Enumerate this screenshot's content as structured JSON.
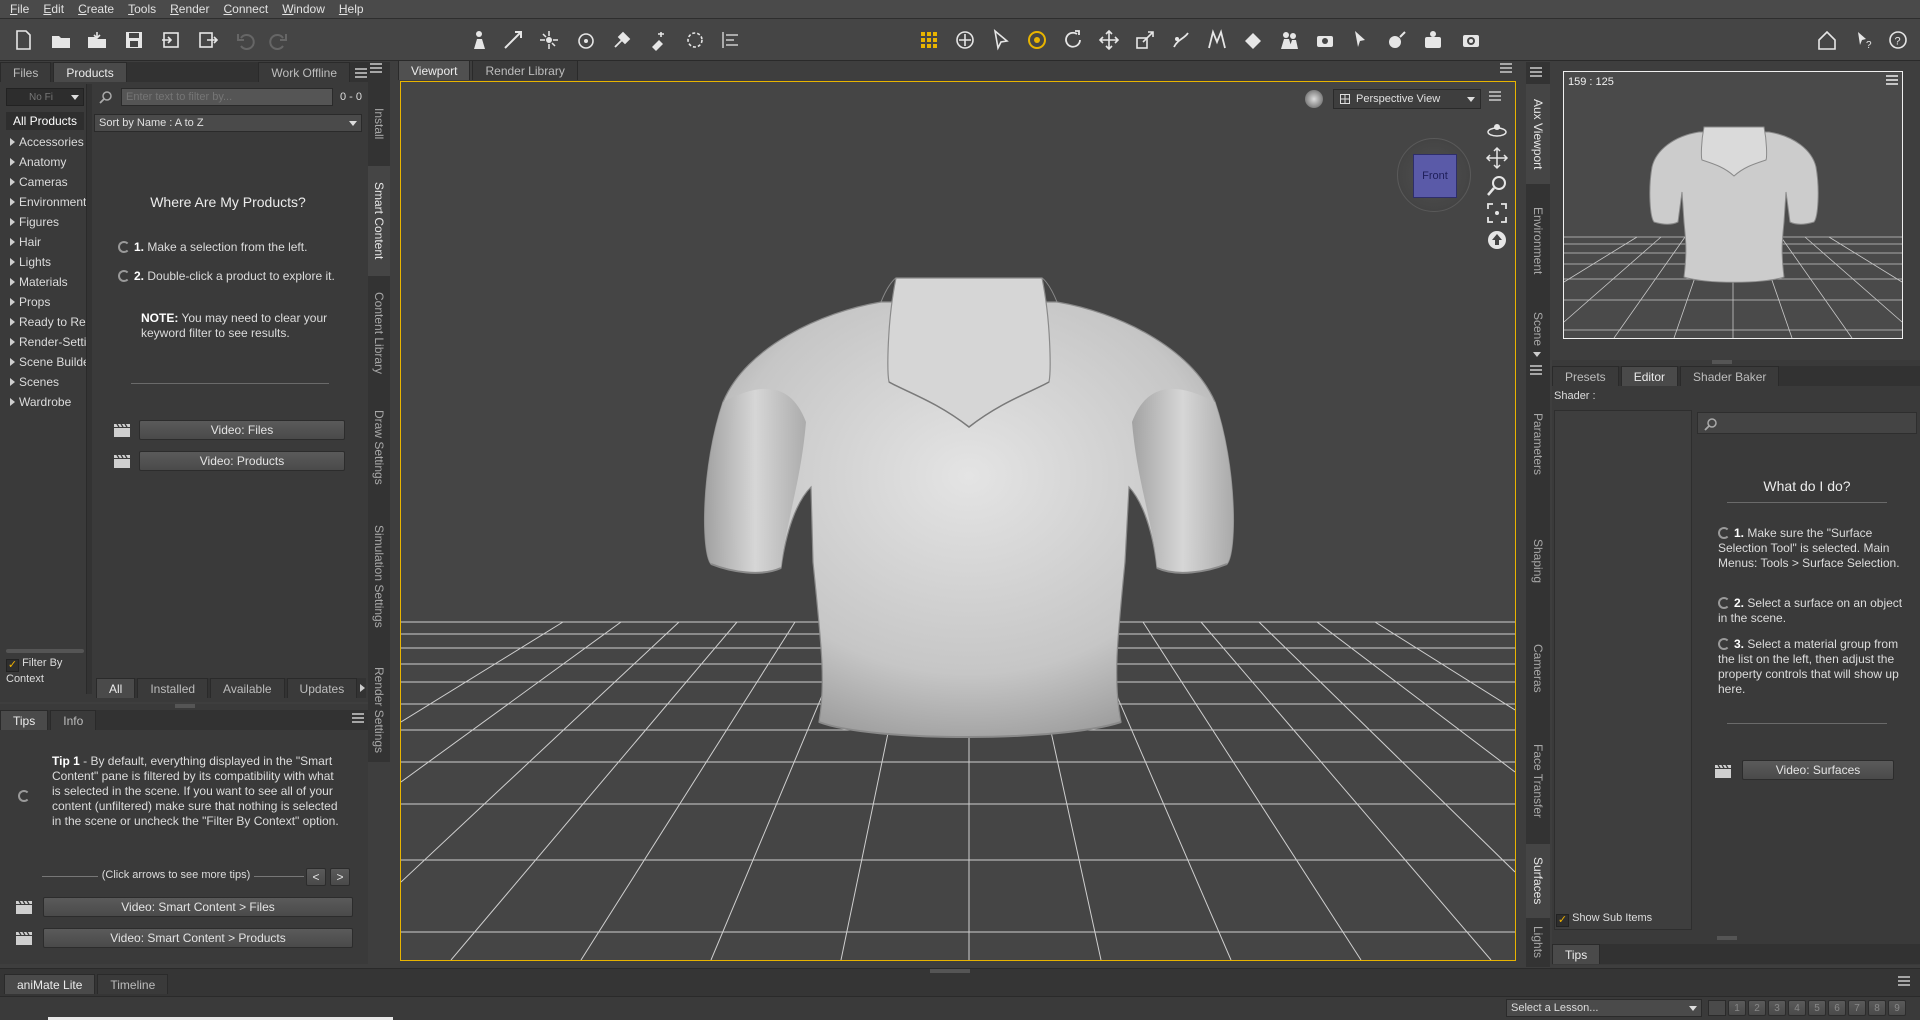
{
  "menu": [
    "File",
    "Edit",
    "Create",
    "Tools",
    "Render",
    "Connect",
    "Window",
    "Help"
  ],
  "left": {
    "tabs": [
      "Files",
      "Products"
    ],
    "work_offline": "Work Offline",
    "filter_dropdown": "No Fi",
    "search_placeholder": "Enter text to filter by...",
    "count": "0 - 0",
    "all_products": "All Products",
    "sort": "Sort by Name : A to Z",
    "categories": [
      "Accessories",
      "Anatomy",
      "Cameras",
      "Environments",
      "Figures",
      "Hair",
      "Lights",
      "Materials",
      "Props",
      "Ready to Rend",
      "Render-Settin",
      "Scene Builder",
      "Scenes",
      "Wardrobe"
    ],
    "where_title": "Where Are My Products?",
    "step1_num": "1.",
    "step1": "Make a selection from the left.",
    "step2_num": "2.",
    "step2": "Double-click a product to explore it.",
    "note_label": "NOTE:",
    "note": "You may need to clear your keyword filter to see results.",
    "video_files": "Video: Files",
    "video_products": "Video: Products",
    "filter_by_context": "Filter By Context",
    "bottom_tabs": [
      "All",
      "Installed",
      "Available",
      "Updates"
    ],
    "side_tabs": [
      "Install",
      "Smart Content",
      "Content Library",
      "Draw Settings",
      "Simulation Settings",
      "Render Settings"
    ]
  },
  "tips": {
    "tabs": [
      "Tips",
      "Info"
    ],
    "tip_label": "Tip 1",
    "tip_text": " - By default, everything displayed in the \"Smart Content\" pane is filtered by its compatibility with what is selected in the scene. If you want to see all of your content (unfiltered) make sure that nothing is selected in the scene or uncheck the \"Filter By Context\" option.",
    "more": "(Click arrows to see more tips)",
    "prev": "<",
    "next": ">",
    "video_sc_files": "Video: Smart Content > Files",
    "video_sc_products": "Video: Smart Content > Products"
  },
  "viewport": {
    "tabs": [
      "Viewport",
      "Render Library"
    ],
    "view": "Perspective View",
    "cube_label": "Front"
  },
  "right": {
    "aux_ratio": "159 : 125",
    "side_tabs_top": [
      "Aux Viewport",
      "Environment",
      "Scene"
    ],
    "side_tabs": [
      "Parameters",
      "Shaping",
      "Cameras",
      "Face Transfer",
      "Surfaces",
      "Lights"
    ],
    "tabs": [
      "Presets",
      "Editor",
      "Shader Baker"
    ],
    "shader_label": "Shader :",
    "what_title": "What do I do?",
    "s1_num": "1.",
    "s1": "Make sure the \"Surface Selection Tool\" is selected. Main Menus: Tools > Surface Selection.",
    "s2_num": "2.",
    "s2": "Select a surface on an object in the scene.",
    "s3_num": "3.",
    "s3": "Select a material group from the list on the left, then adjust the property controls that will show up here.",
    "video_surfaces": "Video: Surfaces",
    "show_sub": "Show Sub Items",
    "tips_tab": "Tips"
  },
  "bottom": {
    "tabs": [
      "aniMate Lite",
      "Timeline"
    ],
    "lesson": "Select a Lesson...",
    "pages": [
      "1",
      "2",
      "3",
      "4",
      "5",
      "6",
      "7",
      "8",
      "9"
    ]
  },
  "colors": {
    "accent": "#e8b400",
    "viewport_bg": "#454545",
    "grid": "#cfcfcf",
    "cube": "#5a5aa8"
  }
}
